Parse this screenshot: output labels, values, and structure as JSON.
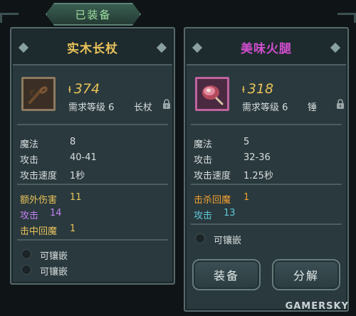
{
  "equipped_tab": {
    "label": "已装备"
  },
  "left_item": {
    "name": "实木长杖",
    "name_color": "#e8c25a",
    "icon": "staff-icon",
    "power": "374",
    "requirement": "需求等级 6",
    "weapon_type": "长杖",
    "locked": true,
    "stats": [
      {
        "label": "魔法",
        "value": "8"
      },
      {
        "label": "攻击",
        "value": "40-41"
      },
      {
        "label": "攻击速度",
        "value": "1秒"
      }
    ],
    "bonuses": [
      {
        "label": "额外伤害",
        "value": "11",
        "color": "#e8c25a"
      },
      {
        "label": "攻击",
        "value": "14",
        "color": "#c080f0"
      },
      {
        "label": "击中回魔",
        "value": "1",
        "color": "#e8c25a"
      }
    ],
    "sockets": [
      {
        "label": "可镶嵌"
      },
      {
        "label": "可镶嵌"
      }
    ]
  },
  "right_item": {
    "name": "美味火腿",
    "name_color": "#d24ecf",
    "icon": "ham-icon",
    "power": "318",
    "requirement": "需求等级 6",
    "weapon_type": "锤",
    "locked": true,
    "stats": [
      {
        "label": "魔法",
        "value": "5"
      },
      {
        "label": "攻击",
        "value": "32-36"
      },
      {
        "label": "攻击速度",
        "value": "1.25秒"
      }
    ],
    "bonuses": [
      {
        "label": "击杀回魔",
        "value": "1",
        "color": "#f0a030"
      },
      {
        "label": "攻击",
        "value": "13",
        "color": "#5cc8d8"
      }
    ],
    "sockets": [
      {
        "label": "可镶嵌"
      }
    ],
    "buttons": {
      "equip": "装备",
      "disassemble": "分解"
    }
  },
  "watermark": "GAMERSKY"
}
